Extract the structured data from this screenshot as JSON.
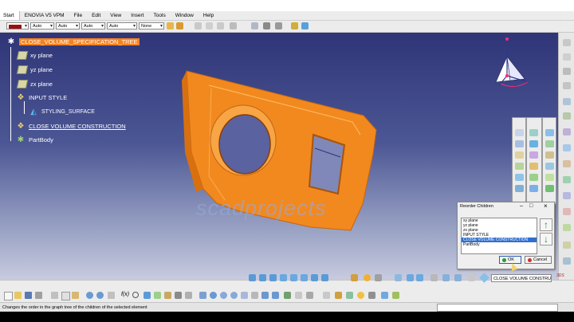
{
  "menu": [
    "Start",
    "ENOVIA V5 VPM",
    "File",
    "Edit",
    "View",
    "Insert",
    "Tools",
    "Window",
    "Help"
  ],
  "toolbar": {
    "selects": [
      "Auto",
      "Auto",
      "Auto",
      "Auto",
      "None"
    ]
  },
  "tree": {
    "root": "CLOSE_VOLUME_SPECIFICATION_TREE",
    "nodes": [
      "xy plane",
      "yz plane",
      "zx plane",
      "INPUT STYLE",
      "STYLING_SURFACE",
      "CLOSE VOLUME CONSTRUCTION",
      "PartBody"
    ]
  },
  "watermark": "scadprojects",
  "reorder_dialog": {
    "title": "Reorder Children",
    "items": [
      "xy plane",
      "yz plane",
      "zx plane",
      "INPUT STYLE",
      "CLOSE VOLUME CONSTRUCTION",
      "PartBody"
    ],
    "selected": "CLOSE VOLUME CONSTRUCTION",
    "ok": "OK",
    "cancel": "Cancel"
  },
  "bottom": {
    "active_part": "CLOSE VOLUME CONSTRU",
    "status_text": "Changes the order in the graph tree of the children of the selected element"
  },
  "colors": {
    "accent_orange": "#f58220",
    "viewport_top": "#2f3577",
    "viewport_bottom": "#c8cbe0"
  }
}
